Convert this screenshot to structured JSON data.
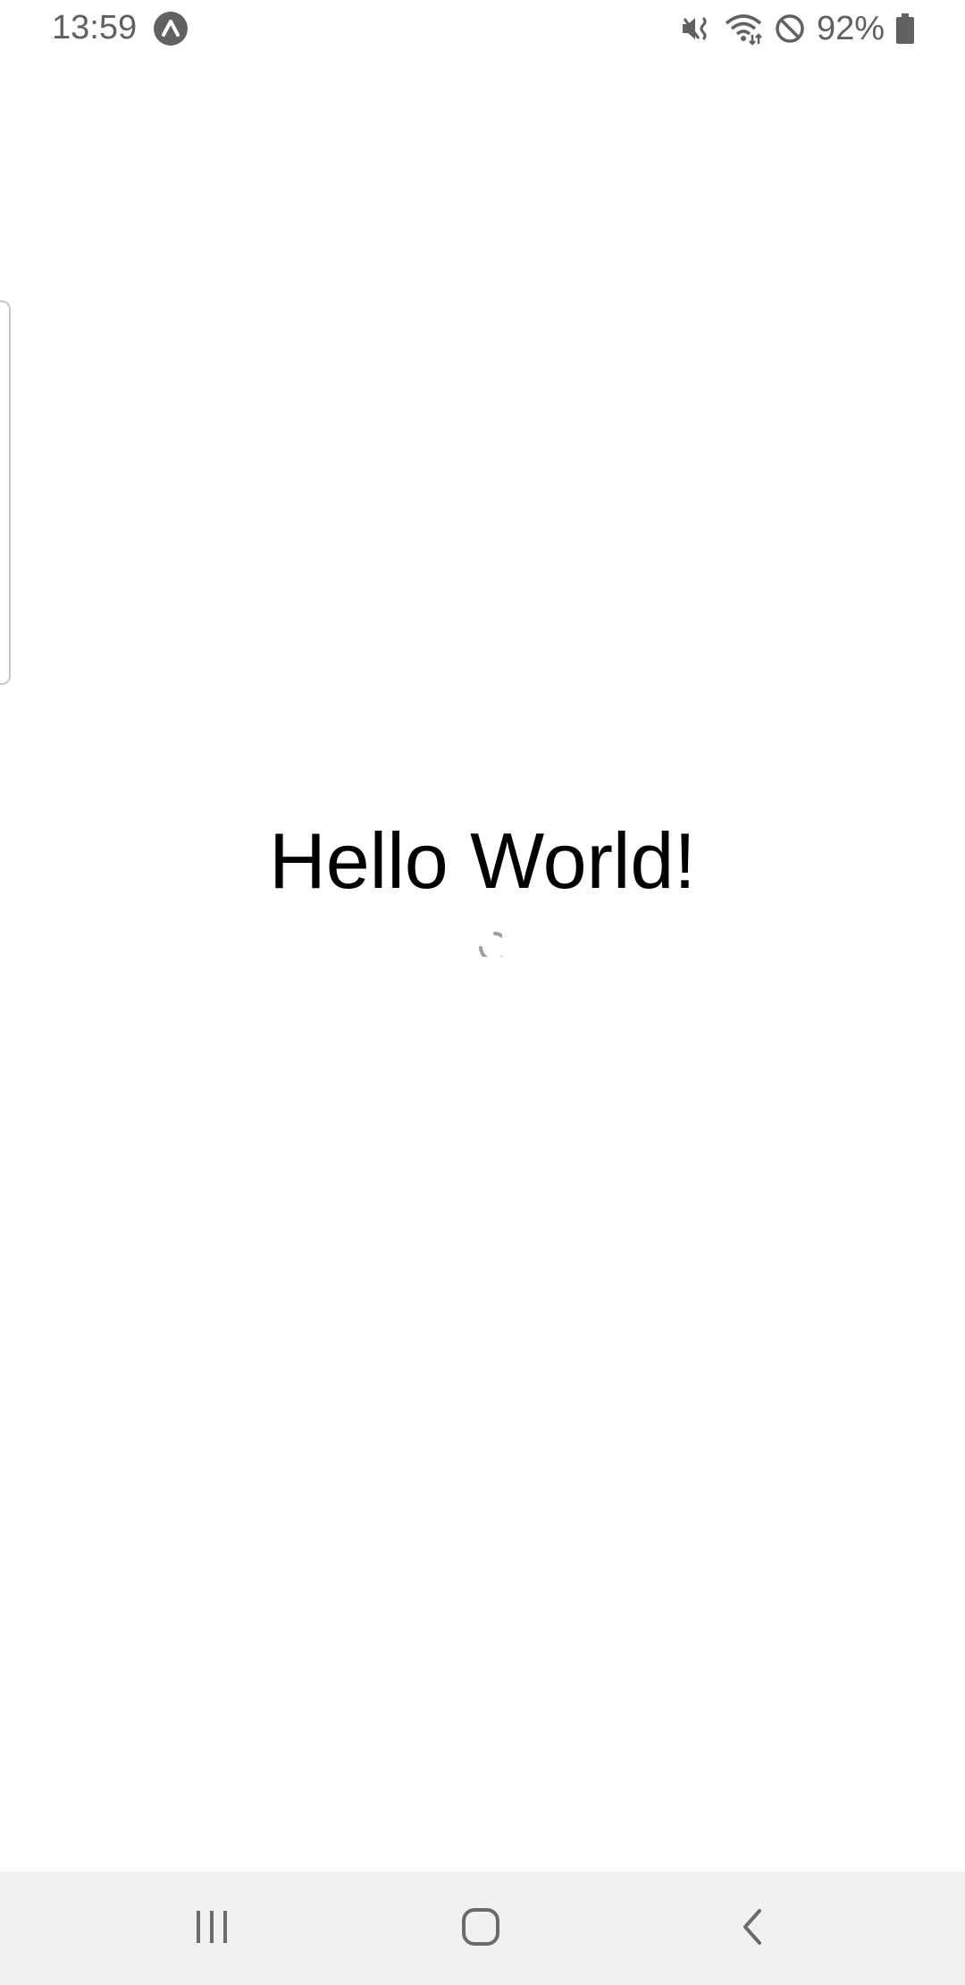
{
  "status_bar": {
    "time": "13:59",
    "app_icon": "expo-icon",
    "icons": [
      "mute-vibrate-icon",
      "wifi-icon",
      "do-not-disturb-icon",
      "battery-icon"
    ],
    "battery_percent": "92%"
  },
  "main": {
    "heading": "Hello World!",
    "loading_indicator": "spinner"
  },
  "nav_bar": {
    "buttons": [
      "recents-icon",
      "home-icon",
      "back-icon"
    ]
  },
  "colors": {
    "status_text": "#616161",
    "heading_text": "#000000",
    "nav_background": "#f1f1f1",
    "nav_icon": "#6b6b6b"
  }
}
